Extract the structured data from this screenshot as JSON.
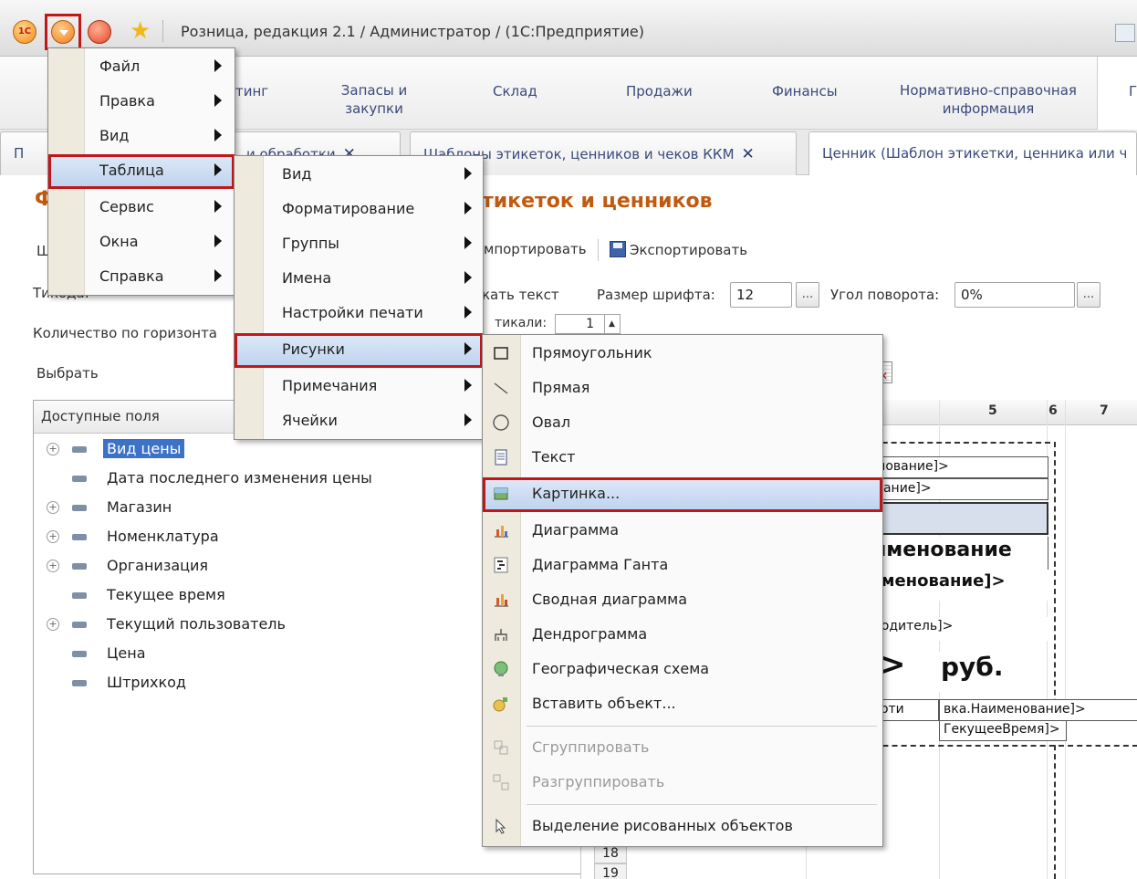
{
  "titlebar": {
    "app_logo": "1С",
    "title": "Розница, редакция 2.1 / Администратор /  (1С:Предприятие)"
  },
  "sections": [
    {
      "label": "тинг"
    },
    {
      "label": "Запасы и закупки"
    },
    {
      "label": "Склад"
    },
    {
      "label": "Продажи"
    },
    {
      "label": "Финансы"
    },
    {
      "label": "Нормативно-справочная информация"
    },
    {
      "label": "Г"
    }
  ],
  "tabs": [
    {
      "label": "П",
      "close": ""
    },
    {
      "label": "и обработки",
      "close": "✕"
    },
    {
      "label": "Шаблоны этикеток, ценников и чеков ККМ",
      "close": "✕"
    },
    {
      "label": "Ценник (Шаблон этикетки, ценника или ч",
      "close": ""
    }
  ],
  "form": {
    "title": "тикеток и ценников",
    "import_label": "мпортировать",
    "export_label": "Экспортировать",
    "text_label": "кать текст",
    "font_size_label": "Размер шрифта:",
    "font_size_value": "12",
    "angle_label": "Угол поворота:",
    "angle_value": "0%",
    "ellipsis": "...",
    "vertical_label": "тикали:",
    "vertical_value": "1",
    "horizontal_label": "Количество по горизонта",
    "type_label": "Ти",
    "type_label_tail": "кода:",
    "choose_label": "Выбрать",
    "cut_label_f": "Ф",
    "cut_label_sh": "Ш",
    "cut_label_p": "Г"
  },
  "fields": {
    "header": "Доступные поля",
    "items": [
      {
        "label": "Вид цены",
        "expandable": true,
        "selected": true
      },
      {
        "label": "Дата последнего изменения цены",
        "expandable": false,
        "selected": false
      },
      {
        "label": "Магазин",
        "expandable": true,
        "selected": false
      },
      {
        "label": "Номенклатура",
        "expandable": true,
        "selected": false
      },
      {
        "label": "Организация",
        "expandable": true,
        "selected": false
      },
      {
        "label": "Текущее время",
        "expandable": false,
        "selected": false
      },
      {
        "label": "Текущий пользователь",
        "expandable": true,
        "selected": false
      },
      {
        "label": "Цена",
        "expandable": false,
        "selected": false
      },
      {
        "label": "Штрихкод",
        "expandable": false,
        "selected": false
      }
    ]
  },
  "sheet": {
    "columns": [
      "5",
      "6",
      "7"
    ],
    "rows": [
      "18",
      "19"
    ],
    "cells": [
      "менование]>",
      "нование]>",
      "аименование",
      "аименование]>",
      "изводитель]>",
      "а>",
      "руб.",
      "а.Арти",
      "вка.Наименование]>",
      "ГекущееВремя]>"
    ]
  },
  "main_menu": {
    "items": [
      {
        "label": "Файл",
        "submenu": true
      },
      {
        "label": "Правка",
        "submenu": true
      },
      {
        "label": "Вид",
        "submenu": true
      },
      {
        "label": "Таблица",
        "submenu": true
      },
      {
        "label": "Сервис",
        "submenu": true
      },
      {
        "label": "Окна",
        "submenu": true
      },
      {
        "label": "Справка",
        "submenu": true
      }
    ]
  },
  "table_menu": {
    "items": [
      {
        "label": "Вид"
      },
      {
        "label": "Форматирование"
      },
      {
        "label": "Группы"
      },
      {
        "label": "Имена"
      },
      {
        "label": "Настройки печати"
      },
      {
        "label": "Рисунки"
      },
      {
        "label": "Примечания"
      },
      {
        "label": "Ячейки"
      }
    ]
  },
  "drawings_menu": {
    "items": [
      {
        "label": "Прямоугольник",
        "icon": "rectangle-icon"
      },
      {
        "label": "Прямая",
        "icon": "line-icon"
      },
      {
        "label": "Овал",
        "icon": "oval-icon"
      },
      {
        "label": "Текст",
        "icon": "text-icon"
      },
      {
        "label": "Картинка...",
        "icon": "picture-icon"
      },
      {
        "label": "Диаграмма",
        "icon": "chart-icon"
      },
      {
        "label": "Диаграмма Ганта",
        "icon": "gantt-icon"
      },
      {
        "label": "Сводная диаграмма",
        "icon": "pivot-chart-icon"
      },
      {
        "label": "Дендрограмма",
        "icon": "dendrogram-icon"
      },
      {
        "label": "Географическая схема",
        "icon": "geo-scheme-icon"
      },
      {
        "label": "Вставить объект...",
        "icon": "insert-object-icon"
      },
      {
        "label": "Сгруппировать",
        "icon": "group-icon"
      },
      {
        "label": "Разгруппировать",
        "icon": "ungroup-icon"
      },
      {
        "label": "Выделение рисованных объектов",
        "icon": "cursor-icon"
      }
    ]
  },
  "colors": {
    "highlight_outline": "#c0171a",
    "menu_highlight": "#bcd2ee",
    "selected_field": "#3c72c8",
    "form_title": "#c05a10"
  }
}
